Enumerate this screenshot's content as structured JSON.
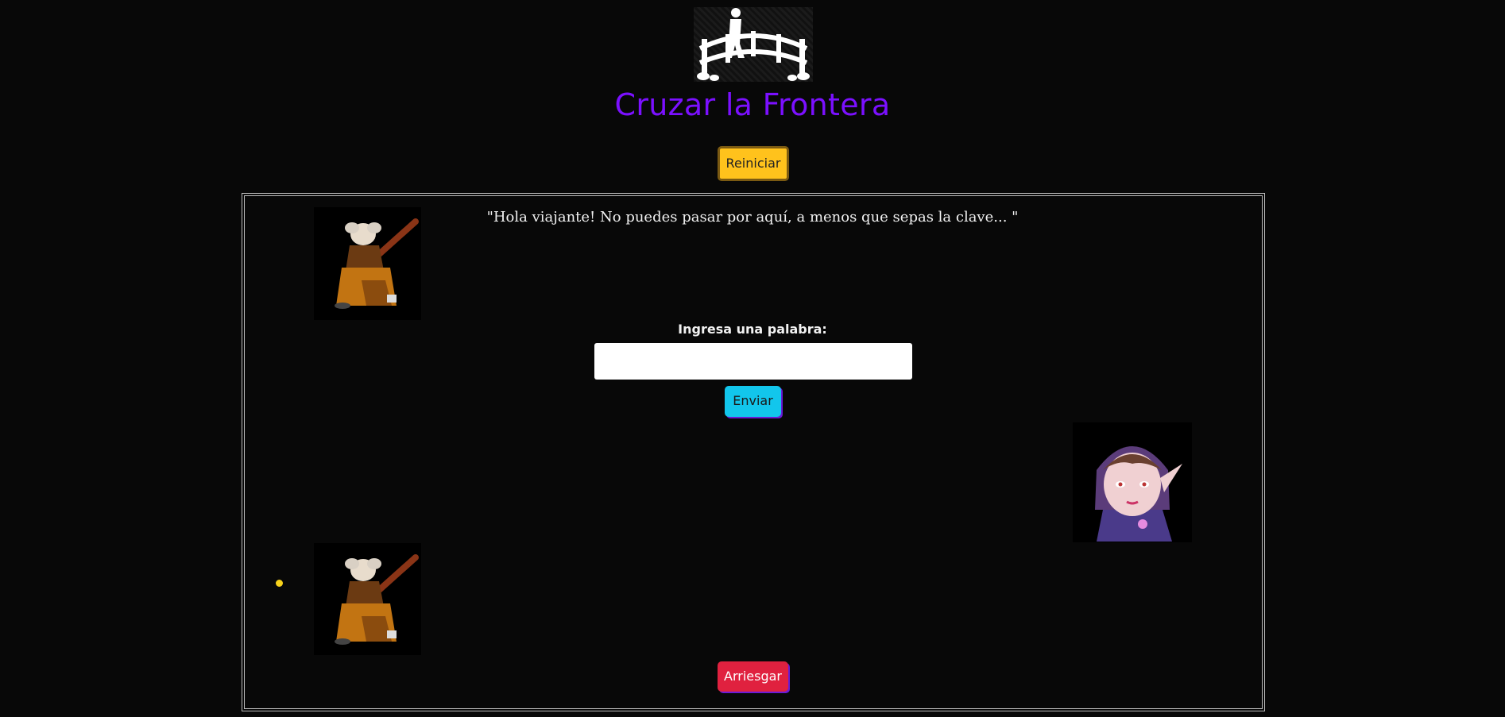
{
  "header": {
    "logo": "bridge-walker-logo",
    "title": "Cruzar la Frontera",
    "reset_label": "Reiniciar"
  },
  "game": {
    "npc_speech": "\"Hola viajante! No puedes pasar por aquí, a menos que sepas la clave... \"",
    "input_label": "Ingresa una palabra:",
    "input_value": "",
    "input_placeholder": "",
    "send_label": "Enviar",
    "risk_label": "Arriesgar",
    "portraits": [
      "old-witch-portrait",
      "elf-girl-portrait",
      "old-witch-portrait"
    ]
  },
  "colors": {
    "background": "#080808",
    "title": "#7b10ff",
    "reset": "#ffc21c",
    "send": "#12c6ec",
    "risk": "#e0213f",
    "indicator": "#f7d21b"
  }
}
